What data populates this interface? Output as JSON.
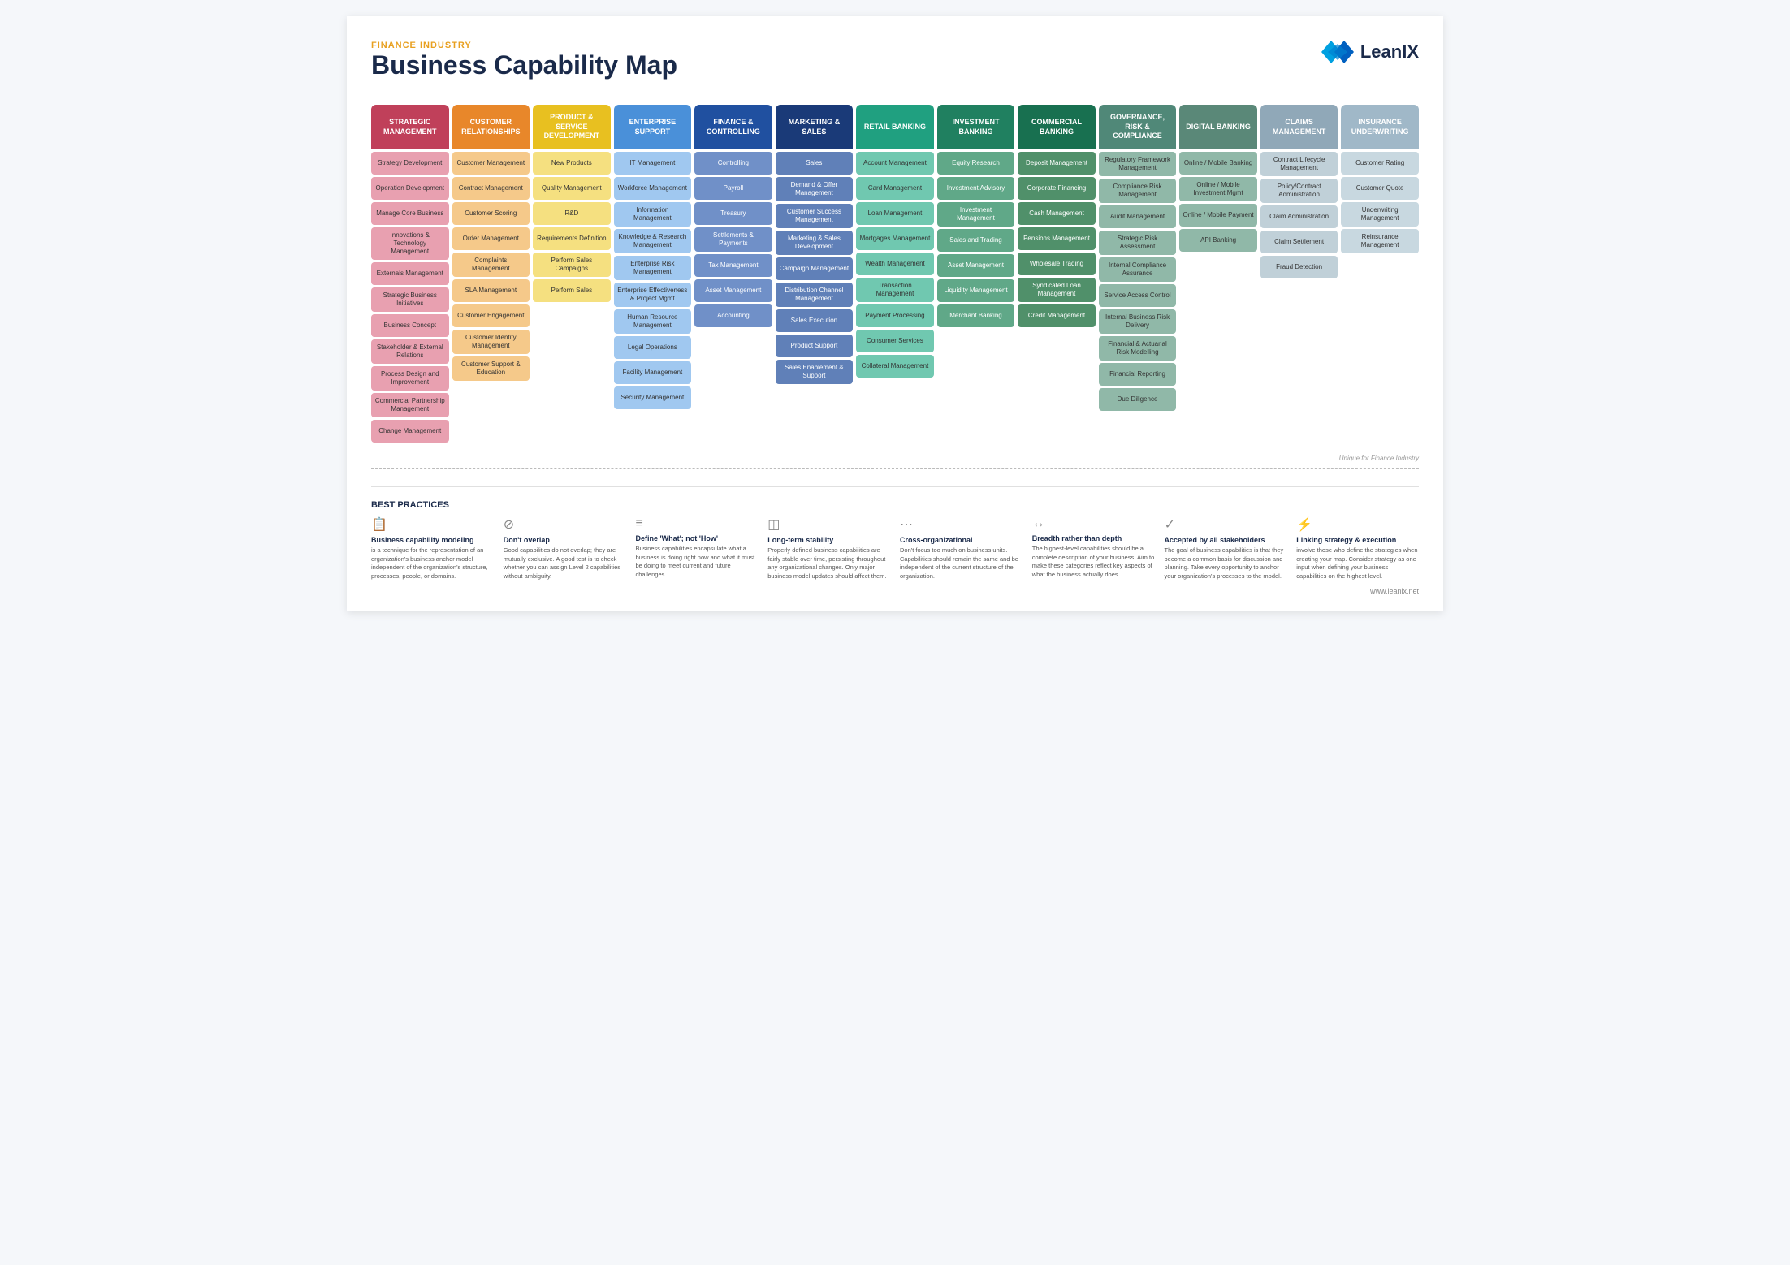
{
  "header": {
    "industry_label": "FINANCE INDUSTRY",
    "title": "Business Capability Map",
    "logo_text": "LeanIX",
    "url": "www.leanix.net"
  },
  "columns": [
    {
      "id": "strategic",
      "header": "STRATEGIC MANAGEMENT",
      "color_class": "strategic",
      "light_class": "strategic-light",
      "cells": [
        "Strategy Development",
        "Operation Development",
        "Manage Core Business",
        "Innovations & Technology Management",
        "Externals Management",
        "Strategic Business Initiatives",
        "Business Concept",
        "Stakeholder & External Relations",
        "Process Design and Improvement",
        "Commercial Partnership Management",
        "Change Management"
      ]
    },
    {
      "id": "customer",
      "header": "CUSTOMER RELATIONSHIPS",
      "color_class": "customer",
      "light_class": "customer-light",
      "cells": [
        "Customer Management",
        "Contract Management",
        "Customer Scoring",
        "Order Management",
        "Complaints Management",
        "SLA Management",
        "Customer Engagement",
        "Customer Identity Management",
        "Customer Support & Education"
      ]
    },
    {
      "id": "product",
      "header": "PRODUCT & SERVICE DEVELOPMENT",
      "color_class": "product",
      "light_class": "product-light",
      "cells": [
        "New Products",
        "Quality Management",
        "R&D",
        "Requirements Definition",
        "Perform Sales Campaigns",
        "Perform Sales"
      ]
    },
    {
      "id": "enterprise",
      "header": "ENTERPRISE SUPPORT",
      "color_class": "enterprise",
      "light_class": "enterprise-light",
      "cells": [
        "IT Management",
        "Workforce Management",
        "Information Management",
        "Knowledge & Research Management",
        "Enterprise Risk Management",
        "Enterprise Effectiveness & Project Mgmt",
        "Human Resource Management",
        "Legal Operations",
        "Facility Management",
        "Security Management"
      ]
    },
    {
      "id": "finance",
      "header": "FINANCE & CONTROLLING",
      "color_class": "finance",
      "light_class": "finance-light",
      "cells": [
        "Controlling",
        "Payroll",
        "Treasury",
        "Settlements & Payments",
        "Tax Management",
        "Asset Management",
        "Accounting"
      ]
    },
    {
      "id": "marketing",
      "header": "MARKETING & SALES",
      "color_class": "marketing",
      "light_class": "marketing-light",
      "cells": [
        "Sales",
        "Demand & Offer Management",
        "Customer Success Management",
        "Marketing & Sales Development",
        "Campaign Management",
        "Distribution Channel Management",
        "Sales Execution",
        "Product Support",
        "Sales Enablement & Support"
      ]
    },
    {
      "id": "retail",
      "header": "RETAIL BANKING",
      "color_class": "retail",
      "light_class": "retail-light",
      "cells": [
        "Account Management",
        "Card Management",
        "Loan Management",
        "Mortgages Management",
        "Wealth Management",
        "Transaction Management",
        "Payment Processing",
        "Consumer Services",
        "Collateral Management"
      ]
    },
    {
      "id": "investment",
      "header": "INVESTMENT BANKING",
      "color_class": "investment",
      "light_class": "investment-light",
      "cells": [
        "Equity Research",
        "Investment Advisory",
        "Investment Management",
        "Sales and Trading",
        "Asset Management",
        "Liquidity Management",
        "Merchant Banking"
      ]
    },
    {
      "id": "commercial",
      "header": "COMMERCIAL BANKING",
      "color_class": "commercial",
      "light_class": "commercial-light",
      "cells": [
        "Deposit Management",
        "Corporate Financing",
        "Cash Management",
        "Pensions Management",
        "Wholesale Trading",
        "Syndicated Loan Management",
        "Credit Management"
      ]
    },
    {
      "id": "governance",
      "header": "GOVERNANCE, RISK & COMPLIANCE",
      "color_class": "governance",
      "light_class": "governance-light",
      "cells": [
        "Regulatory Framework Management",
        "Compliance Risk Management",
        "Audit Management",
        "Strategic Risk Assessment",
        "Internal Compliance Assurance",
        "Service Access Control",
        "Internal Business Risk Delivery",
        "Financial & Actuarial Risk Modelling",
        "Financial Reporting",
        "Due Diligence"
      ]
    },
    {
      "id": "digital",
      "header": "DIGITAL BANKING",
      "color_class": "digital",
      "light_class": "digital-light",
      "cells": [
        "Online / Mobile Banking",
        "Online / Mobile Investment Mgmt",
        "Online / Mobile Payment",
        "API Banking"
      ]
    },
    {
      "id": "claims",
      "header": "CLAIMS MANAGEMENT",
      "color_class": "claims",
      "light_class": "claims-light",
      "cells": [
        "Contract Lifecycle Management",
        "Policy/Contract Administration",
        "Claim Administration",
        "Claim Settlement",
        "Fraud Detection"
      ]
    },
    {
      "id": "insurance",
      "header": "INSURANCE UNDERWRITING",
      "color_class": "insurance",
      "light_class": "insurance-light",
      "cells": [
        "Customer Rating",
        "Customer Quote",
        "Underwriting Management",
        "Reinsurance Management"
      ]
    }
  ],
  "unique_label": "Unique for Finance Industry",
  "best_practices": {
    "title": "BEST PRACTICES",
    "items": [
      {
        "icon": "📋",
        "title": "Business capability modeling",
        "text": "is a technique for the representation of an organization's business anchor model independent of the organization's structure, processes, people, or domains."
      },
      {
        "icon": "⊘",
        "title": "Don't overlap",
        "text": "Good capabilities do not overlap; they are mutually exclusive. A good test is to check whether you can assign Level 2 capabilities without ambiguity."
      },
      {
        "icon": "≡",
        "title": "Define 'What'; not 'How'",
        "text": "Business capabilities encapsulate what a business is doing right now and what it must be doing to meet current and future challenges."
      },
      {
        "icon": "◫",
        "title": "Long-term stability",
        "text": "Properly defined business capabilities are fairly stable over time, persisting throughout any organizational changes. Only major business model updates should affect them."
      },
      {
        "icon": "⋯",
        "title": "Cross-organizational",
        "text": "Don't focus too much on business units. Capabilities should remain the same and be independent of the current structure of the organization."
      },
      {
        "icon": "↔",
        "title": "Breadth rather than depth",
        "text": "The highest-level capabilities should be a complete description of your business. Aim to make these categories reflect key aspects of what the business actually does."
      },
      {
        "icon": "✓",
        "title": "Accepted by all stakeholders",
        "text": "The goal of business capabilities is that they become a common basis for discussion and planning. Take every opportunity to anchor your organization's processes to the model."
      },
      {
        "icon": "⚡",
        "title": "Linking strategy & execution",
        "text": "involve those who define the strategies when creating your map. Consider strategy as one input when defining your business capabilities on the highest level."
      }
    ]
  }
}
